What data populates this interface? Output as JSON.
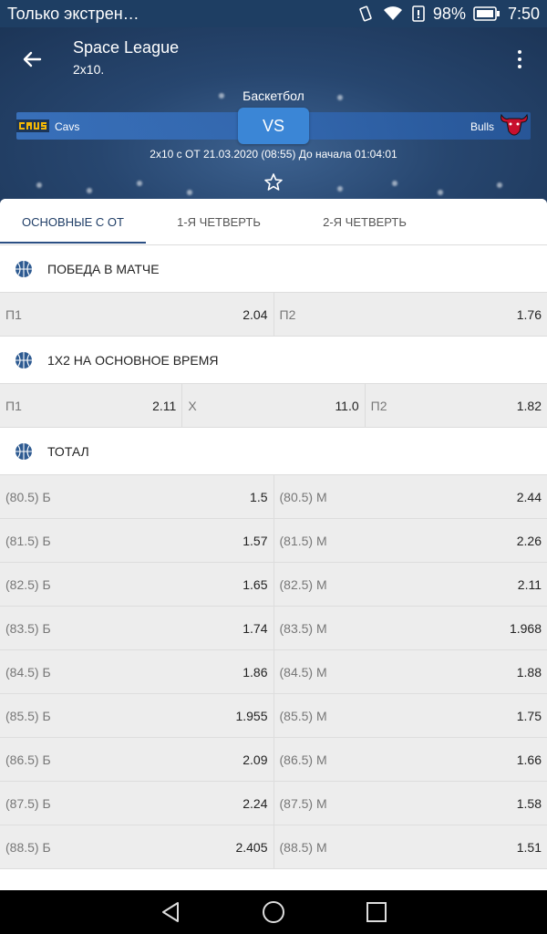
{
  "status_bar": {
    "notification": "Только экстрен…",
    "battery": "98%",
    "time": "7:50"
  },
  "header": {
    "title": "Space League",
    "subtitle": "2х10.",
    "sport": "Баскетбол",
    "team1": "Cavs",
    "team2": "Bulls",
    "vs": "VS",
    "match_info": "2х10 с ОТ 21.03.2020 (08:55) До начала 01:04:01"
  },
  "tabs": [
    {
      "label": "ОСНОВНЫЕ С ОТ"
    },
    {
      "label": "1-Я ЧЕТВЕРТЬ"
    },
    {
      "label": "2-Я ЧЕТВЕРТЬ"
    }
  ],
  "markets": {
    "win": {
      "title": "ПОБЕДА В МАТЧЕ",
      "odds": [
        {
          "label": "П1",
          "value": "2.04"
        },
        {
          "label": "П2",
          "value": "1.76"
        }
      ]
    },
    "x12": {
      "title": "1Х2 НА ОСНОВНОЕ ВРЕМЯ",
      "odds": [
        {
          "label": "П1",
          "value": "2.11"
        },
        {
          "label": "Х",
          "value": "11.0"
        },
        {
          "label": "П2",
          "value": "1.82"
        }
      ]
    },
    "total": {
      "title": "ТОТАЛ",
      "rows": [
        {
          "over_label": "(80.5) Б",
          "over": "1.5",
          "under_label": "(80.5) М",
          "under": "2.44"
        },
        {
          "over_label": "(81.5) Б",
          "over": "1.57",
          "under_label": "(81.5) М",
          "under": "2.26"
        },
        {
          "over_label": "(82.5) Б",
          "over": "1.65",
          "under_label": "(82.5) М",
          "under": "2.11"
        },
        {
          "over_label": "(83.5) Б",
          "over": "1.74",
          "under_label": "(83.5) М",
          "under": "1.968"
        },
        {
          "over_label": "(84.5) Б",
          "over": "1.86",
          "under_label": "(84.5) М",
          "under": "1.88"
        },
        {
          "over_label": "(85.5) Б",
          "over": "1.955",
          "under_label": "(85.5) М",
          "under": "1.75"
        },
        {
          "over_label": "(86.5) Б",
          "over": "2.09",
          "under_label": "(86.5) М",
          "under": "1.66"
        },
        {
          "over_label": "(87.5) Б",
          "over": "2.24",
          "under_label": "(87.5) М",
          "under": "1.58"
        },
        {
          "over_label": "(88.5) Б",
          "over": "2.405",
          "under_label": "(88.5) М",
          "under": "1.51"
        }
      ]
    }
  },
  "icons": {
    "back": "arrow-left-icon",
    "menu": "more-vert-icon",
    "favorite": "star-outline-icon",
    "market": "basketball-icon"
  },
  "colors": {
    "header_bg": "#27466f",
    "accent": "#3b86d6",
    "tab_indicator": "#2b4f84",
    "market_icon": "#2d5a91"
  }
}
